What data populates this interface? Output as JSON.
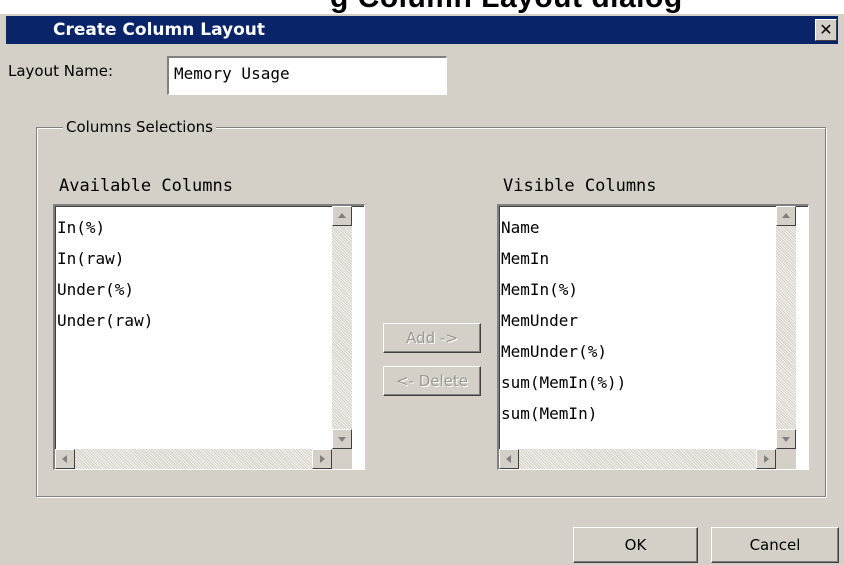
{
  "background": {
    "partial_title": "g Column Layout dialog"
  },
  "dialog": {
    "title": "Create Column Layout",
    "close_glyph": "✕",
    "layout_name_label": "Layout Name:",
    "layout_name_value": "Memory Usage",
    "group_label": "Columns Selections",
    "available": {
      "heading": "Available Columns",
      "items": [
        "In(%)",
        "In(raw)",
        "Under(%)",
        "Under(raw)"
      ]
    },
    "visible": {
      "heading": "Visible Columns",
      "items": [
        "Name",
        "MemIn",
        "MemIn(%)",
        "MemUnder",
        "MemUnder(%)",
        "sum(MemIn(%))",
        "sum(MemIn)"
      ]
    },
    "add_label": "Add ->",
    "delete_label": "<- Delete",
    "ok_label": "OK",
    "cancel_label": "Cancel"
  },
  "colors": {
    "title_bar": "#0a246a",
    "dialog_face": "#d4d0c8",
    "disabled_text": "#9a9890"
  },
  "icons": [
    "close-icon",
    "scroll-up-icon",
    "scroll-down-icon",
    "scroll-left-icon",
    "scroll-right-icon"
  ]
}
